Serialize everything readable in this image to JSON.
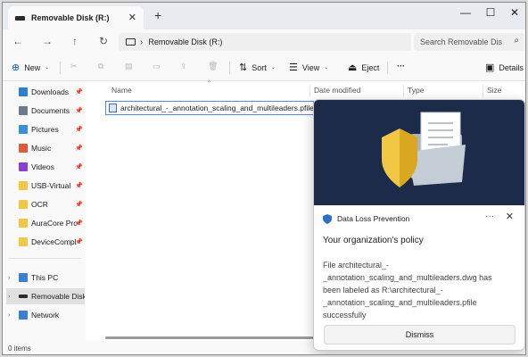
{
  "window": {
    "tab_title": "Removable Disk (R:)",
    "new_tab": "+",
    "controls": {
      "minimize": "—",
      "maximize": "☐",
      "close": "✕"
    }
  },
  "nav": {
    "back": "←",
    "forward": "→",
    "up": "↑",
    "refresh": "↻",
    "address": "Removable Disk (R:)",
    "address_sep": "›",
    "search_placeholder": "Search Removable Dis",
    "search_icon": "search-icon"
  },
  "toolbar": {
    "new_label": "New",
    "sort_label": "Sort",
    "view_label": "View",
    "eject_label": "Eject",
    "more": "···",
    "details_label": "Details"
  },
  "sidebar": {
    "quick": [
      {
        "label": "Downloads",
        "color": "#2d7dd2"
      },
      {
        "label": "Documents",
        "color": "#6d7a8c"
      },
      {
        "label": "Pictures",
        "color": "#3b8fd9"
      },
      {
        "label": "Music",
        "color": "#e05a3a"
      },
      {
        "label": "Videos",
        "color": "#8a3fd1"
      },
      {
        "label": "USB-Virtual",
        "color": "#f2c744"
      },
      {
        "label": "OCR",
        "color": "#f2c744"
      },
      {
        "label": "AuraCore Pro",
        "color": "#f2c744"
      },
      {
        "label": "DeviceCompl",
        "color": "#f2c744"
      }
    ],
    "tree": [
      {
        "label": "This PC",
        "color": "#3a7fd0"
      },
      {
        "label": "Removable Disk",
        "color": "#2b2b2b"
      },
      {
        "label": "Network",
        "color": "#3a7fd0"
      }
    ]
  },
  "columns": {
    "name": "Name",
    "date": "Date modified",
    "type": "Type",
    "size": "Size"
  },
  "files": [
    {
      "name": "architectural_-_annotation_scaling_and_multileaders.pfile"
    }
  ],
  "status": {
    "items": "0 items"
  },
  "toast": {
    "app_name": "Data Loss Prevention",
    "more": "···",
    "close": "✕",
    "title": "Your organization's policy",
    "body": "File architectural_-_annotation_scaling_and_multileaders.dwg has been labeled as R:\\architectural_-_annotation_scaling_and_multileaders.pfile successfully",
    "dismiss_label": "Dismiss",
    "hero_bg": "#1c2b4a",
    "shield_color": "#f2c744"
  }
}
